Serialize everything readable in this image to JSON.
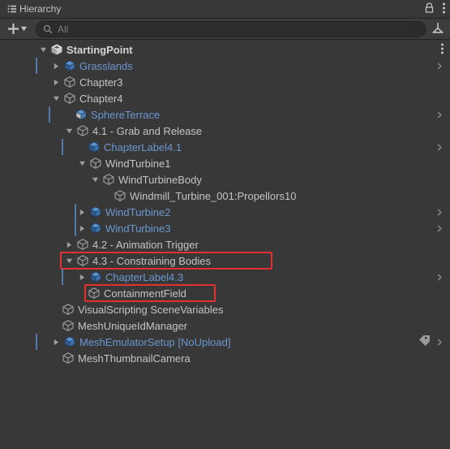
{
  "title": "Hierarchy",
  "search": {
    "placeholder": "All"
  },
  "root": {
    "name": "StartingPoint",
    "items": {
      "grasslands": "Grasslands",
      "chapter3": "Chapter3",
      "chapter4": "Chapter4",
      "sphere": "SphereTerrace",
      "sec41": "4.1 - Grab and Release",
      "cl41": "ChapterLabel4.1",
      "wt1": "WindTurbine1",
      "wtb": "WindTurbineBody",
      "prop": "Windmill_Turbine_001:Propellors10",
      "wt2": "WindTurbine2",
      "wt3": "WindTurbine3",
      "sec42": "4.2 - Animation Trigger",
      "sec43": "4.3 - Constraining Bodies",
      "cl43": "ChapterLabel4.3",
      "cf": "ContainmentField",
      "vss": "VisualScripting SceneVariables",
      "muid": "MeshUniqueIdManager",
      "mesetup": "MeshEmulatorSetup [NoUpload]",
      "thumb": "MeshThumbnailCamera"
    }
  }
}
